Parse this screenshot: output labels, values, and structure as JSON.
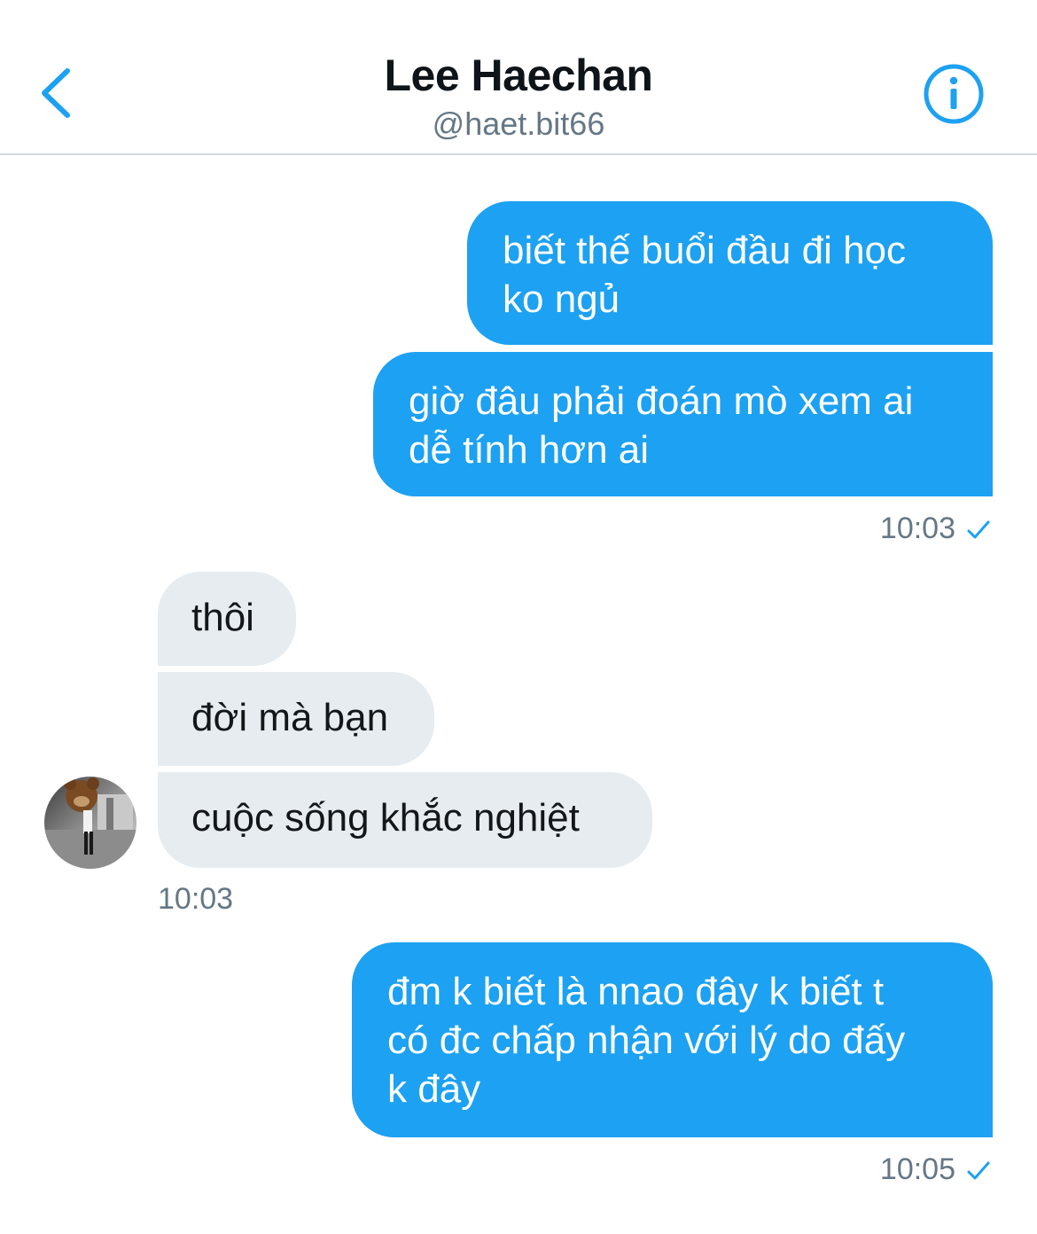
{
  "header": {
    "title": "Lee Haechan",
    "handle": "@haet.bit66",
    "back_icon": "chevron-left-icon",
    "info_icon": "info-circle-icon"
  },
  "colors": {
    "accent": "#1da1f2",
    "incoming_bubble": "#e6ecf0",
    "meta_text": "#657786"
  },
  "messages": [
    {
      "direction": "out",
      "text": "biết thế buổi đầu đi học\nko ngủ"
    },
    {
      "direction": "out",
      "text": "giờ đâu phải đoán mò xem ai\ndễ tính hơn ai"
    },
    {
      "direction": "out",
      "time": "10:03",
      "read_icon": "checkmark-icon"
    },
    {
      "direction": "in",
      "text": "thôi"
    },
    {
      "direction": "in",
      "text": "đời mà bạn"
    },
    {
      "direction": "in",
      "text": "cuộc sống khắc nghiệt"
    },
    {
      "direction": "in",
      "time": "10:03",
      "avatar_icon": "avatar-photo"
    },
    {
      "direction": "out",
      "text": "đm k biết là nnao đây k biết t\ncó đc chấp nhận với lý do đấy\nk đây"
    },
    {
      "direction": "out",
      "time": "10:05",
      "read_icon": "checkmark-icon"
    }
  ]
}
